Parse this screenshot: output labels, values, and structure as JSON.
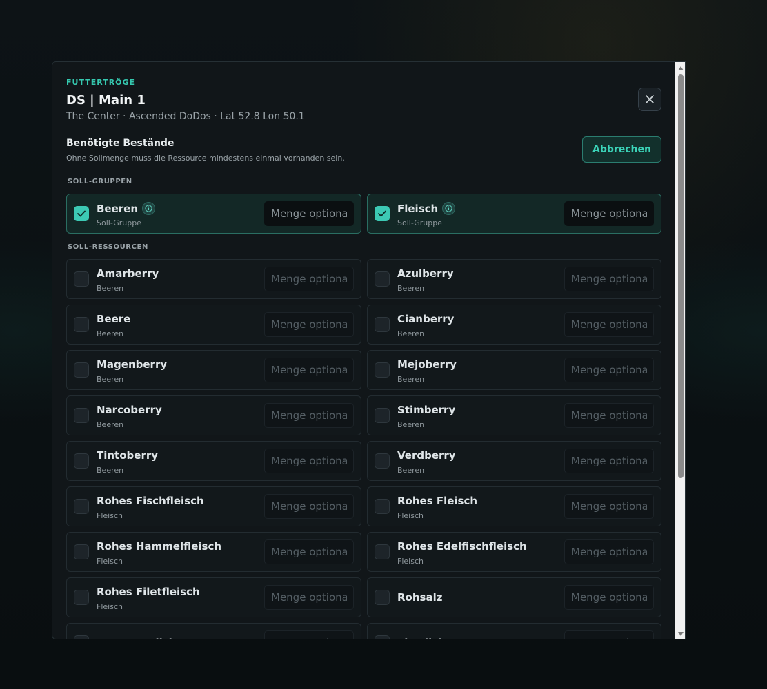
{
  "modal": {
    "eyebrow": "FUTTERTRÖGE",
    "title": "DS | Main 1",
    "subtitle": "The Center · Ascended DoDos · Lat 52.8 Lon 50.1",
    "close_icon": "close-icon"
  },
  "section": {
    "heading": "Benötigte Bestände",
    "hint": "Ohne Sollmenge muss die Ressource mindestens einmal vorhanden sein.",
    "cancel_label": "Abbrechen"
  },
  "groups": {
    "label": "SOLL-GRUPPEN",
    "items": [
      {
        "name": "Beeren",
        "sub": "Soll-Gruppe",
        "checked": true,
        "placeholder": "Menge optional"
      },
      {
        "name": "Fleisch",
        "sub": "Soll-Gruppe",
        "checked": true,
        "placeholder": "Menge optional"
      }
    ]
  },
  "resources": {
    "label": "SOLL-RESSOURCEN",
    "items": [
      {
        "name": "Amarberry",
        "sub": "Beeren",
        "placeholder": "Menge optional"
      },
      {
        "name": "Azulberry",
        "sub": "Beeren",
        "placeholder": "Menge optional"
      },
      {
        "name": "Beere",
        "sub": "Beeren",
        "placeholder": "Menge optional"
      },
      {
        "name": "Cianberry",
        "sub": "Beeren",
        "placeholder": "Menge optional"
      },
      {
        "name": "Magenberry",
        "sub": "Beeren",
        "placeholder": "Menge optional"
      },
      {
        "name": "Mejoberry",
        "sub": "Beeren",
        "placeholder": "Menge optional"
      },
      {
        "name": "Narcoberry",
        "sub": "Beeren",
        "placeholder": "Menge optional"
      },
      {
        "name": "Stimberry",
        "sub": "Beeren",
        "placeholder": "Menge optional"
      },
      {
        "name": "Tintoberry",
        "sub": "Beeren",
        "placeholder": "Menge optional"
      },
      {
        "name": "Verdberry",
        "sub": "Beeren",
        "placeholder": "Menge optional"
      },
      {
        "name": "Rohes Fischfleisch",
        "sub": "Fleisch",
        "placeholder": "Menge optional"
      },
      {
        "name": "Rohes Fleisch",
        "sub": "Fleisch",
        "placeholder": "Menge optional"
      },
      {
        "name": "Rohes Hammelfleisch",
        "sub": "Fleisch",
        "placeholder": "Menge optional"
      },
      {
        "name": "Rohes Edelfischfleisch",
        "sub": "Fleisch",
        "placeholder": "Menge optional"
      },
      {
        "name": "Rohes Filetfleisch",
        "sub": "Fleisch",
        "placeholder": "Menge optional"
      },
      {
        "name": "Rohsalz",
        "sub": "",
        "placeholder": "Menge optional"
      },
      {
        "name": "Wyvern-Milch",
        "sub": "",
        "placeholder": "Menge optional"
      },
      {
        "name": "Eismilch",
        "sub": "",
        "placeholder": "Menge optional"
      }
    ]
  },
  "colors": {
    "accent": "#35c9b0",
    "selected_bg": "#132826",
    "selected_border": "#2a6e62"
  }
}
